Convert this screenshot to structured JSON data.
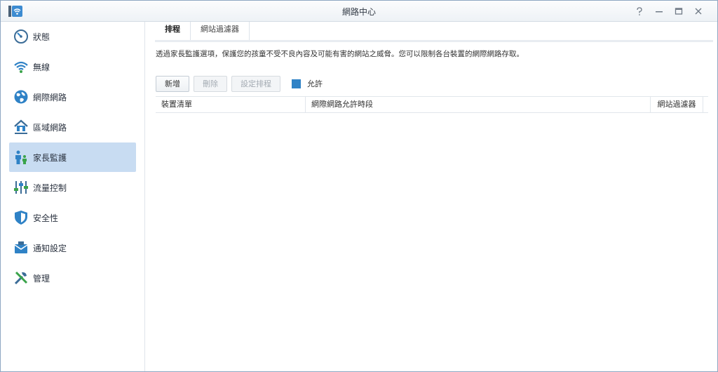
{
  "window": {
    "title": "網路中心",
    "controls": [
      "help-icon",
      "minimize-icon",
      "maximize-icon",
      "close-icon"
    ]
  },
  "sidebar": {
    "items": [
      {
        "label": "狀態",
        "icon": "gauge-icon",
        "active": false
      },
      {
        "label": "無線",
        "icon": "wifi-icon",
        "active": false
      },
      {
        "label": "網際網路",
        "icon": "globe-icon",
        "active": false
      },
      {
        "label": "區域網路",
        "icon": "home-network-icon",
        "active": false
      },
      {
        "label": "家長監護",
        "icon": "parent-child-icon",
        "active": true
      },
      {
        "label": "流量控制",
        "icon": "sliders-icon",
        "active": false
      },
      {
        "label": "安全性",
        "icon": "shield-icon",
        "active": false
      },
      {
        "label": "通知設定",
        "icon": "mail-icon",
        "active": false
      },
      {
        "label": "管理",
        "icon": "tools-icon",
        "active": false
      }
    ]
  },
  "tabs": [
    {
      "label": "排程",
      "active": true
    },
    {
      "label": "網站過濾器",
      "active": false
    }
  ],
  "description": "透過家長監護選項，保護您的孩童不受不良內容及可能有害的網站之威脅。您可以限制各台裝置的網際網路存取。",
  "toolbar": {
    "add_label": "新增",
    "delete_label": "刪除",
    "schedule_label": "設定排程",
    "legend_label": "允許",
    "legend_color": "#2f82c6"
  },
  "table": {
    "columns": [
      "裝置清單",
      "網際網路允許時段",
      "網站過濾器"
    ],
    "rows": []
  },
  "colors": {
    "accent": "#2f82c6",
    "active_nav": "#c8dcf2"
  }
}
